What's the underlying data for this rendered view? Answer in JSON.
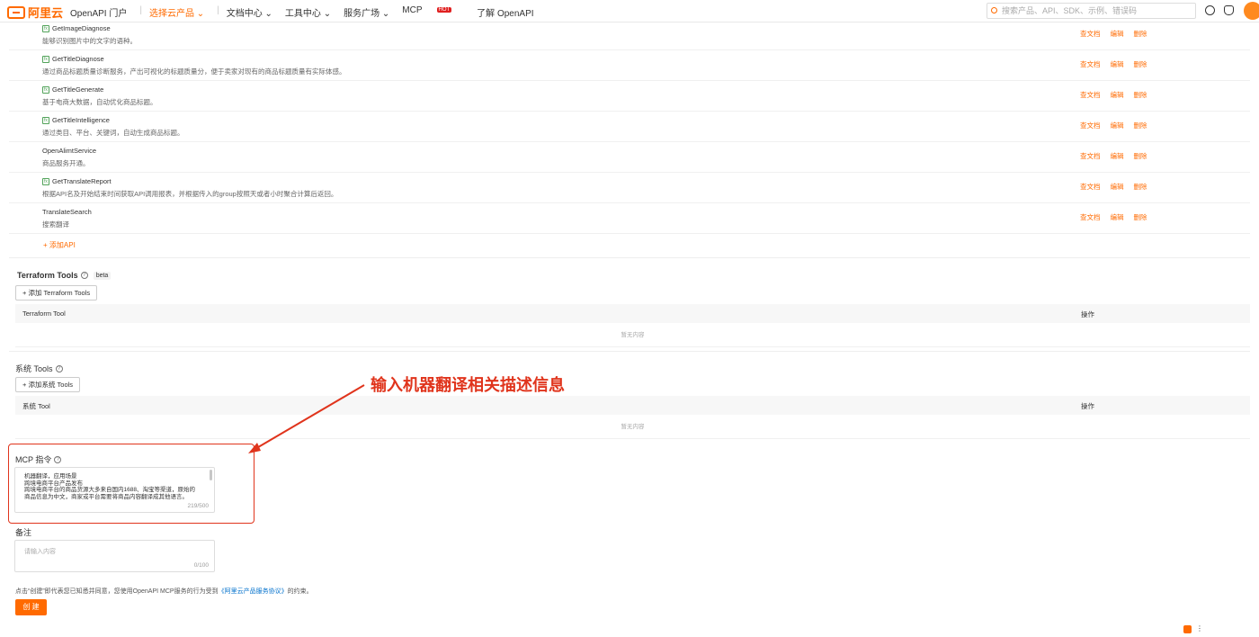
{
  "header": {
    "logo_text": "阿里云",
    "nav": [
      {
        "label": "OpenAPI 门户"
      },
      {
        "label": "选择云产品 ⌄",
        "active": true
      },
      {
        "label": "文档中心 ⌄"
      },
      {
        "label": "工具中心 ⌄"
      },
      {
        "label": "服务广场 ⌄"
      },
      {
        "label": "MCP"
      },
      {
        "label": "了解 OpenAPI"
      }
    ],
    "hot_badge": "HOT",
    "search_placeholder": "搜索产品、API、SDK、示例、错误码"
  },
  "api_list": {
    "rows": [
      {
        "name": "GetImageDiagnose",
        "desc": "能够识别图片中的文字的语种。",
        "fx": true
      },
      {
        "name": "GetTitleDiagnose",
        "desc": "通过商品标题质量诊断服务，产出可视化的标题质量分，便于卖家对现有的商品标题质量有实际体感。",
        "fx": true
      },
      {
        "name": "GetTitleGenerate",
        "desc": "基于电商大数据，自动优化商品标题。",
        "fx": true
      },
      {
        "name": "GetTitleIntelligence",
        "desc": "通过类目、平台、关键词，自动生成商品标题。",
        "fx": true
      },
      {
        "name": "OpenAlimtService",
        "desc": "商品服务开通。",
        "fx": false
      },
      {
        "name": "GetTranslateReport",
        "desc": "根据API名及开始结束时间获取API调用报表，并根据传入的group按照天或者小时聚合计算后返回。",
        "fx": true
      },
      {
        "name": "TranslateSearch",
        "desc": "搜索翻译",
        "fx": false
      }
    ],
    "ops": [
      "查文档",
      "编辑",
      "删除"
    ],
    "fx_label": "fx",
    "add_api": "+ 添加API"
  },
  "terraform": {
    "title": "Terraform Tools",
    "beta": "beta",
    "add_button": "+ 添加 Terraform Tools",
    "col_tool": "Terraform Tool",
    "col_ops": "操作",
    "empty": "暂无内容"
  },
  "system_tools": {
    "title": "系统 Tools",
    "add_button": "+ 添加系统 Tools",
    "col_tool": "系统 Tool",
    "col_ops": "操作",
    "empty": "暂无内容"
  },
  "mcp_instruction": {
    "label": "MCP 指令",
    "value": "机器翻译，应用场景\n跨境电商平台产品发布\n跨境电商平台的商品货源大多来自国内1688、淘宝等渠道，原始的\n商品信息为中文，商家或平台需要将商品内容翻译成其他语言。",
    "count": "219/500"
  },
  "remark": {
    "label": "备注",
    "placeholder": "请输入内容",
    "count": "0/100"
  },
  "annotation": "输入机器翻译相关描述信息",
  "footer": {
    "agree_prefix": "点击“创建”即代表您已知悉并同意，您使用OpenAPI MCP服务的行为受到",
    "agree_link": "《阿里云产品服务协议》",
    "agree_suffix": "的约束。",
    "create_button": "创 建"
  },
  "colors": {
    "accent": "#ff6a00",
    "annotation": "#e0341c",
    "link": "#0070cc"
  }
}
